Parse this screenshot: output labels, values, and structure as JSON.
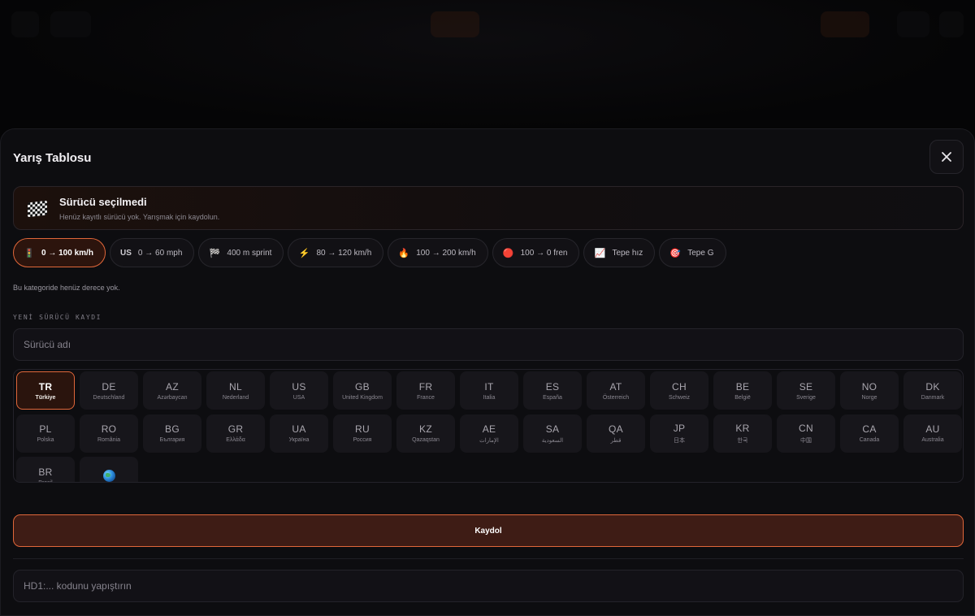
{
  "modal": {
    "title": "Yarış Tablosu",
    "close_icon": "close-icon"
  },
  "banner": {
    "icon": "checkered-flag-icon",
    "title": "Sürücü seçilmedi",
    "subtitle": "Henüz kayıtlı sürücü yok. Yarışmak için kaydolun."
  },
  "categories": [
    {
      "icon": "traffic-light-icon",
      "glyph": "🚦",
      "label": "0 → 100 km/h",
      "active": true
    },
    {
      "icon": "us-icon",
      "glyph": "US",
      "label": "0 → 60 mph",
      "active": false
    },
    {
      "icon": "checkered-flag-icon",
      "glyph": "🏁",
      "label": "400 m sprint",
      "active": false
    },
    {
      "icon": "lightning-icon",
      "glyph": "⚡",
      "label": "80 → 120 km/h",
      "active": false
    },
    {
      "icon": "fire-icon",
      "glyph": "🔥",
      "label": "100 → 200 km/h",
      "active": false
    },
    {
      "icon": "red-circle-icon",
      "glyph": "🔴",
      "label": "100 → 0 fren",
      "active": false
    },
    {
      "icon": "chart-icon",
      "glyph": "📈",
      "label": "Tepe hız",
      "active": false
    },
    {
      "icon": "target-icon",
      "glyph": "🎯",
      "label": "Tepe G",
      "active": false
    }
  ],
  "empty_message": "Bu kategoride henüz derece yok.",
  "registration": {
    "section_title": "YENİ SÜRÜCÜ KAYDI",
    "name_placeholder": "Sürücü adı",
    "submit_label": "Kaydol",
    "code_placeholder": "HD1:... kodunu yapıştırın"
  },
  "countries": [
    {
      "code": "TR",
      "name": "Türkiye",
      "selected": true
    },
    {
      "code": "DE",
      "name": "Deutschland"
    },
    {
      "code": "AZ",
      "name": "Azərbaycan"
    },
    {
      "code": "NL",
      "name": "Nederland"
    },
    {
      "code": "US",
      "name": "USA"
    },
    {
      "code": "GB",
      "name": "United Kingdom"
    },
    {
      "code": "FR",
      "name": "France"
    },
    {
      "code": "IT",
      "name": "Italia"
    },
    {
      "code": "ES",
      "name": "España"
    },
    {
      "code": "AT",
      "name": "Österreich"
    },
    {
      "code": "CH",
      "name": "Schweiz"
    },
    {
      "code": "BE",
      "name": "België"
    },
    {
      "code": "SE",
      "name": "Sverige"
    },
    {
      "code": "NO",
      "name": "Norge"
    },
    {
      "code": "DK",
      "name": "Danmark"
    },
    {
      "code": "PL",
      "name": "Polska"
    },
    {
      "code": "RO",
      "name": "România"
    },
    {
      "code": "BG",
      "name": "България"
    },
    {
      "code": "GR",
      "name": "Ελλάδα"
    },
    {
      "code": "UA",
      "name": "Україна"
    },
    {
      "code": "RU",
      "name": "Россия"
    },
    {
      "code": "KZ",
      "name": "Qazaqstan"
    },
    {
      "code": "AE",
      "name": "الإمارات"
    },
    {
      "code": "SA",
      "name": "السعودية"
    },
    {
      "code": "QA",
      "name": "قطر"
    },
    {
      "code": "JP",
      "name": "日本"
    },
    {
      "code": "KR",
      "name": "한국"
    },
    {
      "code": "CN",
      "name": "中国"
    },
    {
      "code": "CA",
      "name": "Canada"
    },
    {
      "code": "AU",
      "name": "Australia"
    },
    {
      "code": "BR",
      "name": "Brasil"
    },
    {
      "code": "",
      "name": "",
      "icon": "globe-icon"
    }
  ],
  "colors": {
    "accent": "#e0673a",
    "background": "#0d0d10"
  }
}
